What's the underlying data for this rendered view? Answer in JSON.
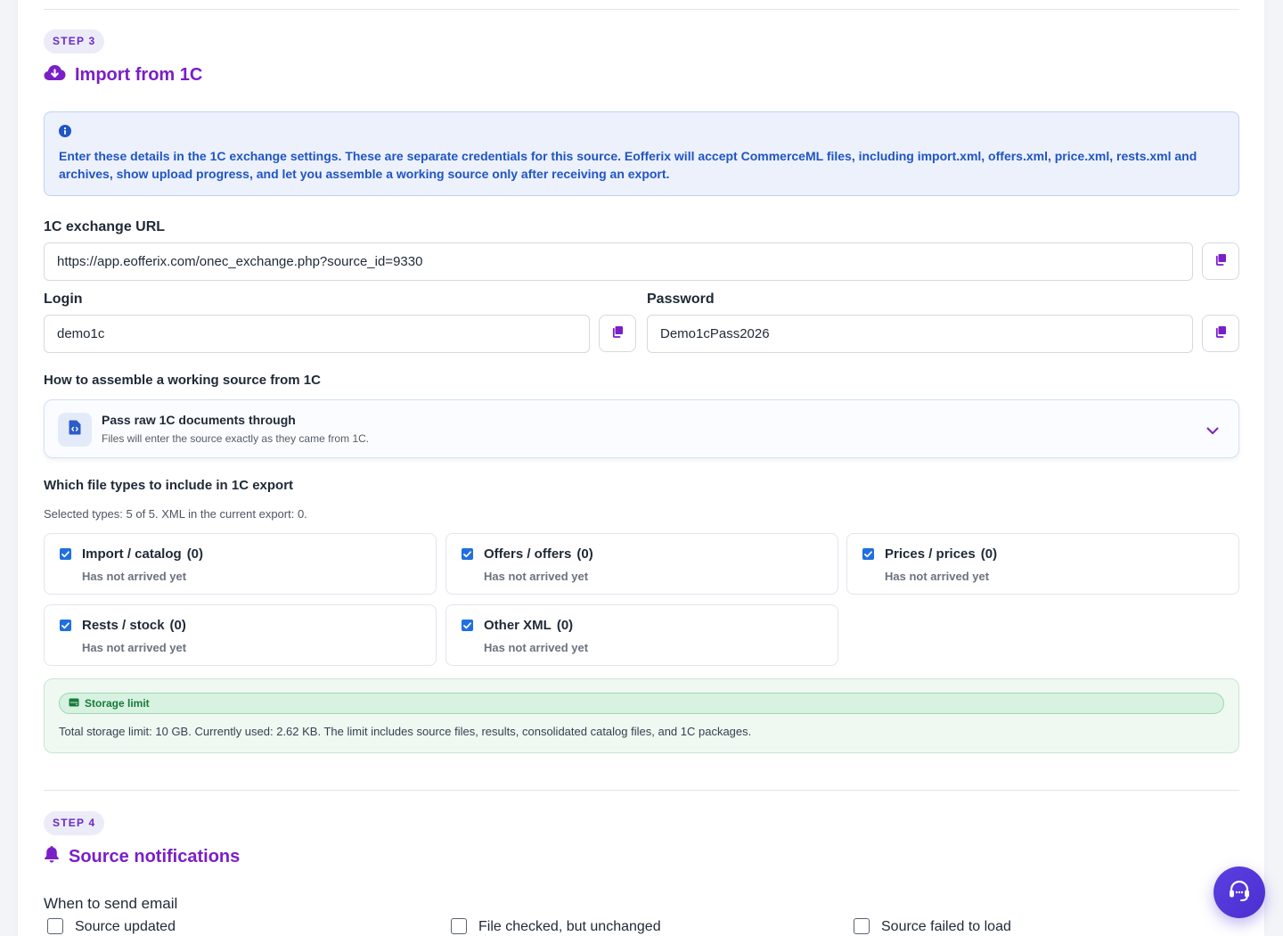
{
  "step3": {
    "badge": "STEP 3",
    "title": "Import from 1C",
    "info_text": "Enter these details in the 1C exchange settings. These are separate credentials for this source. Eofferix will accept CommerceML files, including import.xml, offers.xml, price.xml, rests.xml and archives, show upload progress, and let you assemble a working source only after receiving an export.",
    "exchange_url_label": "1C exchange URL",
    "exchange_url_value": "https://app.eofferix.com/onec_exchange.php?source_id=9330",
    "login_label": "Login",
    "login_value": "demo1c",
    "password_label": "Password",
    "password_value": "Demo1cPass2026",
    "assemble_label": "How to assemble a working source from 1C",
    "assemble_mode": {
      "title": "Pass raw 1C documents through",
      "description": "Files will enter the source exactly as they came from 1C."
    },
    "file_types_label": "Which file types to include in 1C export",
    "file_types_summary": "Selected types: 5 of 5. XML in the current export: 0.",
    "file_types": [
      {
        "label": "Import / catalog",
        "count": "(0)",
        "status": "Has not arrived yet",
        "checked": true
      },
      {
        "label": "Offers / offers",
        "count": "(0)",
        "status": "Has not arrived yet",
        "checked": true
      },
      {
        "label": "Prices / prices",
        "count": "(0)",
        "status": "Has not arrived yet",
        "checked": true
      },
      {
        "label": "Rests / stock",
        "count": "(0)",
        "status": "Has not arrived yet",
        "checked": true
      },
      {
        "label": "Other XML",
        "count": "(0)",
        "status": "Has not arrived yet",
        "checked": true
      }
    ],
    "storage": {
      "badge": "Storage limit",
      "text": "Total storage limit: 10 GB. Currently used: 2.62 KB. The limit includes source files, results, consolidated catalog files, and 1C packages."
    }
  },
  "step4": {
    "badge": "STEP 4",
    "title": "Source notifications",
    "email_label": "When to send email",
    "options": [
      {
        "label": "Source updated",
        "checked": false
      },
      {
        "label": "File checked, but unchanged",
        "checked": false
      },
      {
        "label": "Source failed to load",
        "checked": false
      }
    ]
  },
  "icons": {
    "step3_title_icon": "cloud-download-icon",
    "step4_title_icon": "bell-icon",
    "info_icon": "info-icon",
    "copy_icon": "copy-icon",
    "mode_icon": "file-code-icon",
    "chevron_icon": "chevron-down-icon",
    "storage_icon": "hard-drive-icon",
    "support_icon": "headset-icon"
  },
  "colors": {
    "accent": "#7a1fc7",
    "info": "#1f55c4",
    "checkbox": "#1f6fe0",
    "success": "#187a3a",
    "support_button": "#5b3fe0"
  }
}
